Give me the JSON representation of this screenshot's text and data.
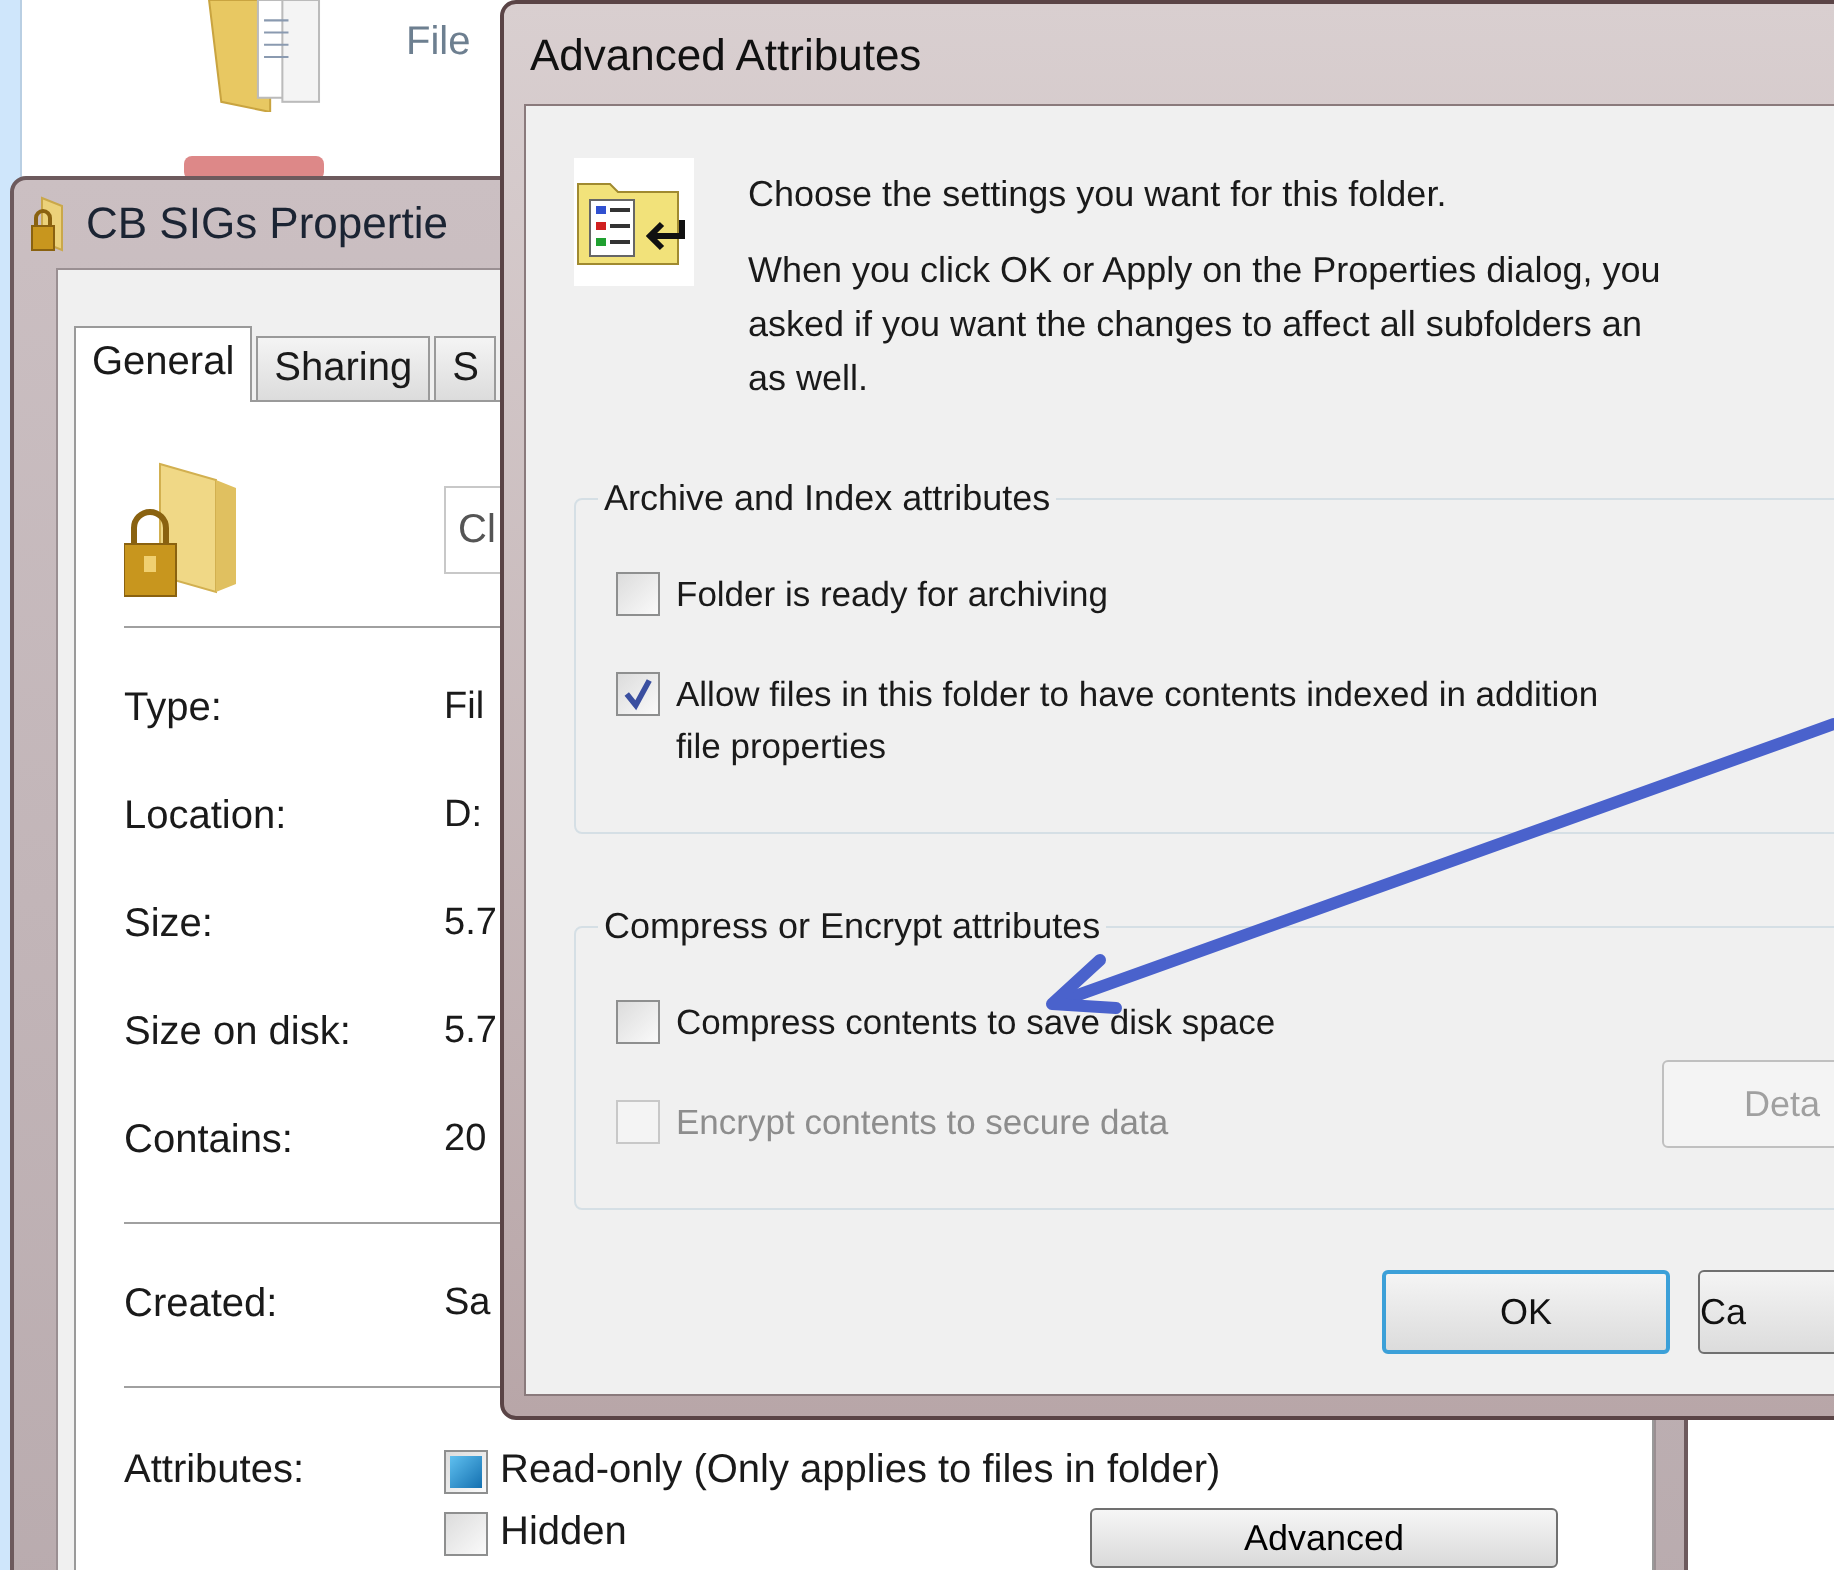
{
  "background_window": {
    "column_text": "File"
  },
  "properties": {
    "title": "CB SIGs Propertie",
    "tabs": [
      {
        "label": "General",
        "selected": true
      },
      {
        "label": "Sharing",
        "selected": false
      },
      {
        "label": "S",
        "selected": false
      }
    ],
    "name_field": {
      "value": "Cl"
    },
    "sections": [
      [
        {
          "label": "Type:",
          "value": "Fil"
        },
        {
          "label": "Location:",
          "value": "D:"
        },
        {
          "label": "Size:",
          "value": "5.7"
        },
        {
          "label": "Size on disk:",
          "value": "5.7"
        },
        {
          "label": "Contains:",
          "value": "20"
        }
      ],
      [
        {
          "label": "Created:",
          "value": "Sa"
        }
      ]
    ],
    "attributes": {
      "label": "Attributes:",
      "items": [
        {
          "label": "Read-only (Only applies to files in folder)",
          "mixed": true
        },
        {
          "label": "Hidden",
          "mixed": false
        }
      ],
      "advanced_button": "Advanced"
    }
  },
  "dialog": {
    "title": "Advanced Attributes",
    "heading": "Choose the settings you want for this folder.",
    "explanation": [
      "When you click OK or Apply on the Properties dialog, you",
      "asked if you want the changes to affect all subfolders an",
      "as well."
    ],
    "groups": [
      {
        "title": "Archive and Index attributes",
        "options": [
          {
            "lines": [
              "Folder is ready for archiving"
            ],
            "checked": false,
            "disabled": false
          },
          {
            "lines": [
              "Allow files in this folder to have contents indexed in addition",
              "file properties"
            ],
            "checked": true,
            "disabled": false
          }
        ]
      },
      {
        "title": "Compress or Encrypt attributes",
        "options": [
          {
            "lines": [
              "Compress contents to save disk space"
            ],
            "checked": false,
            "disabled": false
          },
          {
            "lines": [
              "Encrypt contents to secure data"
            ],
            "checked": false,
            "disabled": true
          }
        ],
        "details_button": {
          "label": "Deta",
          "disabled": true
        }
      }
    ],
    "buttons": [
      {
        "label": "OK",
        "default": true
      },
      {
        "label": "Ca",
        "default": false
      }
    ]
  }
}
